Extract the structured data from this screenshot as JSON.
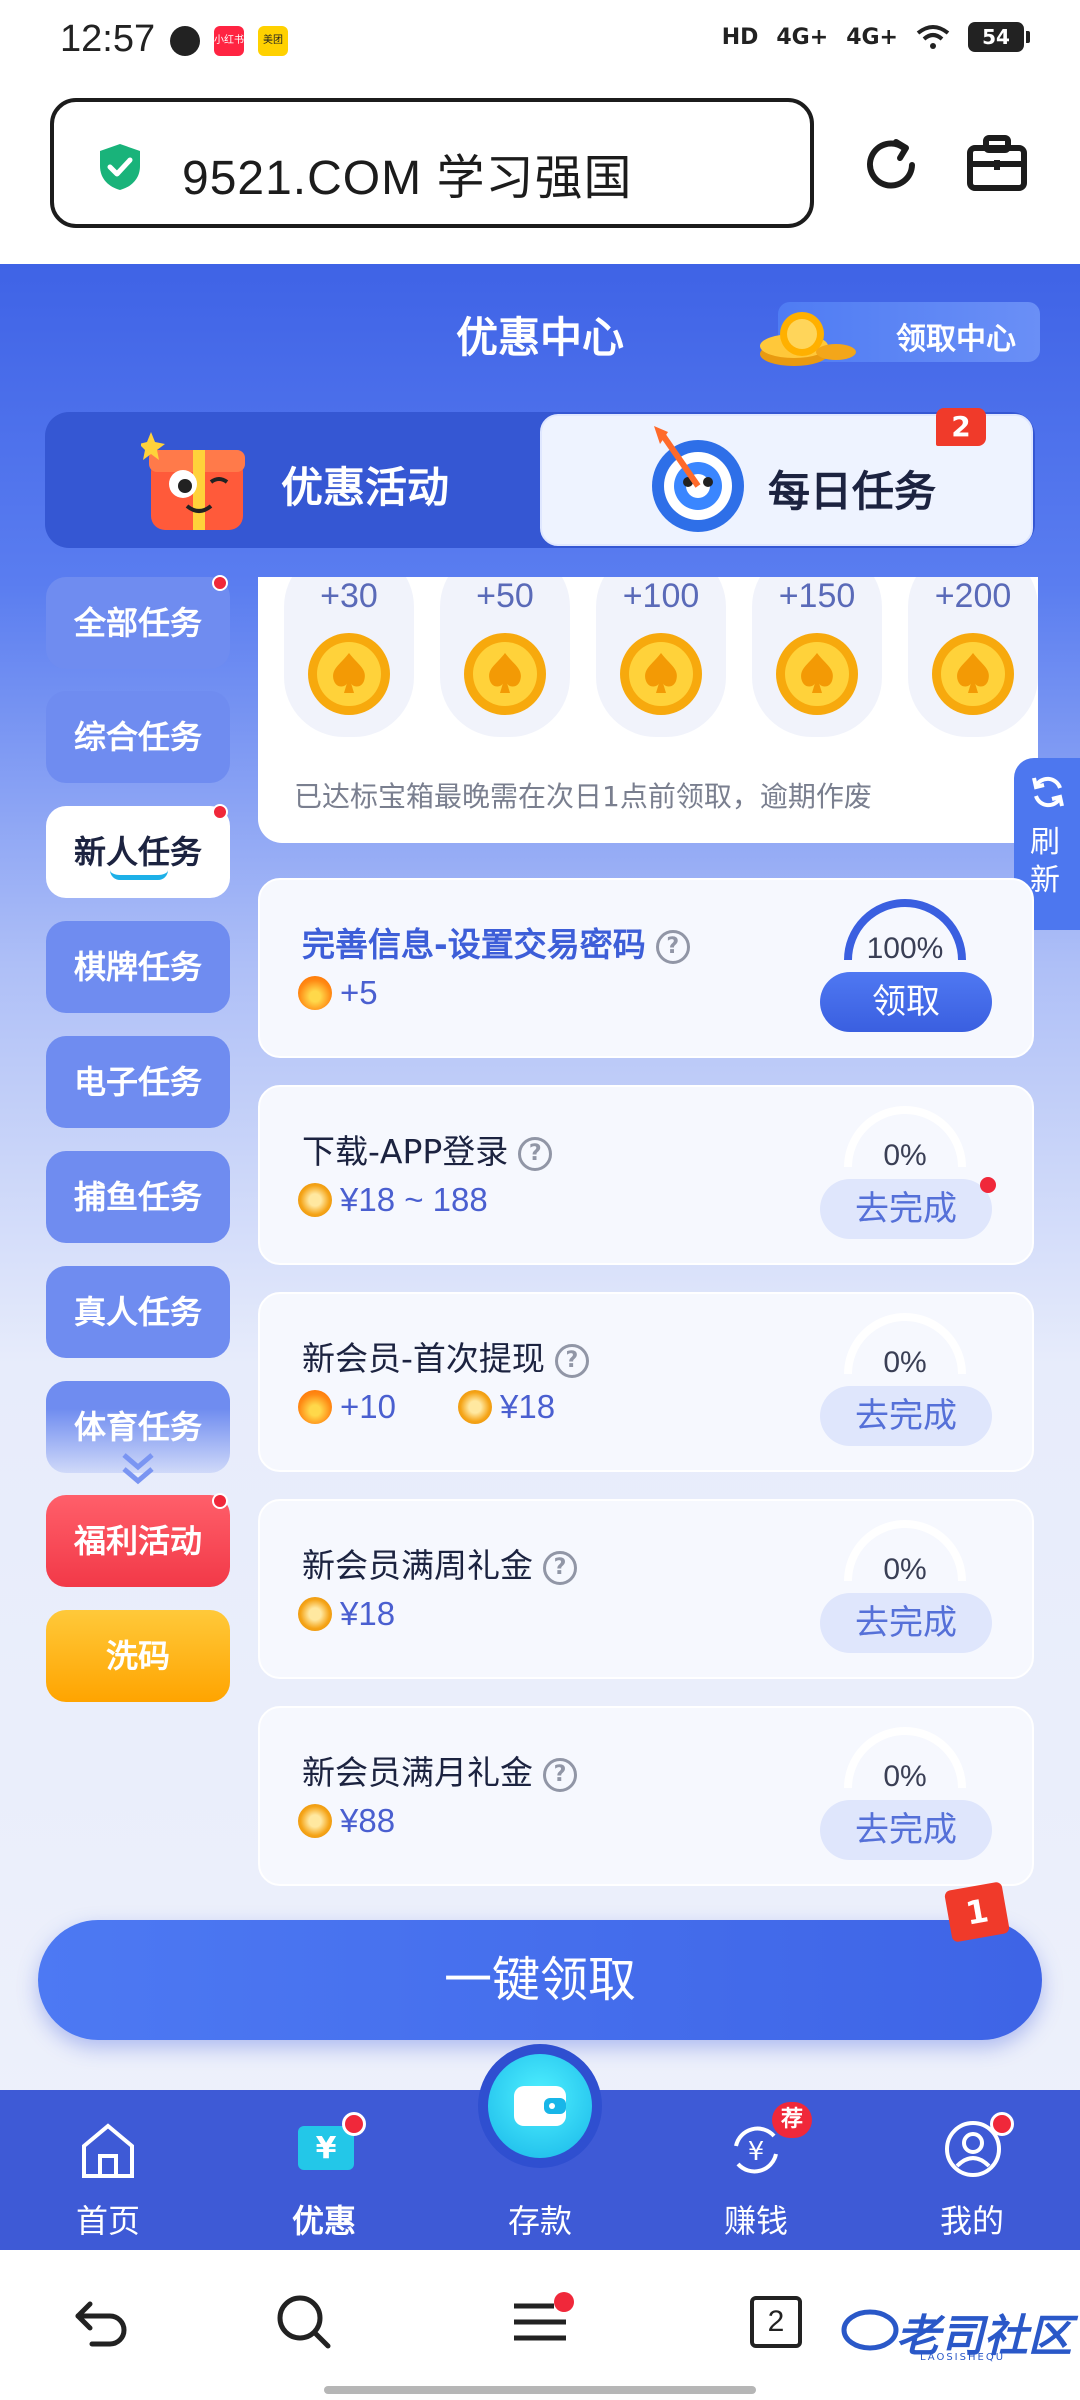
{
  "status_bar": {
    "time": "12:57",
    "apps": [
      "小红书",
      "美团"
    ],
    "network": "4G+",
    "hd_label": "HD",
    "battery": "54"
  },
  "browser": {
    "url": "9521.COM 学习强国",
    "tab_count": "2"
  },
  "page": {
    "title": "优惠中心",
    "claim_center": "领取中心"
  },
  "tabs": {
    "left_label": "优惠活动",
    "right_label": "每日任务",
    "right_badge": "2"
  },
  "sidebar": {
    "items": [
      {
        "label": "全部任务",
        "dot": true
      },
      {
        "label": "综合任务",
        "dot": false
      },
      {
        "label": "新人任务",
        "dot": true,
        "active": true
      },
      {
        "label": "棋牌任务",
        "dot": false
      },
      {
        "label": "电子任务",
        "dot": false
      },
      {
        "label": "捕鱼任务",
        "dot": false
      },
      {
        "label": "真人任务",
        "dot": false
      },
      {
        "label": "体育任务",
        "dot": false
      },
      {
        "label": "福利活动",
        "dot": true
      },
      {
        "label": "洗码",
        "dot": false
      }
    ]
  },
  "treasure": {
    "amounts": [
      "+30",
      "+50",
      "+100",
      "+150",
      "+200"
    ],
    "note": "已达标宝箱最晚需在次日1点前领取，逾期作废"
  },
  "refresh_label": "刷新",
  "tasks": [
    {
      "title": "完善信息-设置交易密码",
      "rewards": [
        {
          "icon": "flame",
          "text": "+5"
        }
      ],
      "progress": "100%",
      "button": "领取"
    },
    {
      "title": "下载-APP登录",
      "rewards": [
        {
          "icon": "money-bag",
          "text": "¥18 ~ 188"
        }
      ],
      "progress": "0%",
      "button": "去完成"
    },
    {
      "title": "新会员-首次提现",
      "rewards": [
        {
          "icon": "flame",
          "text": "+10"
        },
        {
          "icon": "money-bag",
          "text": "¥18"
        }
      ],
      "progress": "0%",
      "button": "去完成"
    },
    {
      "title": "新会员满周礼金",
      "rewards": [
        {
          "icon": "money-bag",
          "text": "¥18"
        }
      ],
      "progress": "0%",
      "button": "去完成"
    },
    {
      "title": "新会员满月礼金",
      "rewards": [
        {
          "icon": "money-bag",
          "text": "¥88"
        }
      ],
      "progress": "0%",
      "button": "去完成"
    }
  ],
  "one_click": {
    "label": "一键领取",
    "badge": "1"
  },
  "bottom_nav": {
    "items": [
      "首页",
      "优惠",
      "存款",
      "赚钱",
      "我的"
    ],
    "rec_badge": "荐"
  },
  "watermark": {
    "text": "老司社区",
    "sub": "LAOSISHEQU"
  },
  "colors": {
    "primary": "#3f63e6",
    "accent_red": "#f0283a",
    "gold": "#ffa400"
  }
}
